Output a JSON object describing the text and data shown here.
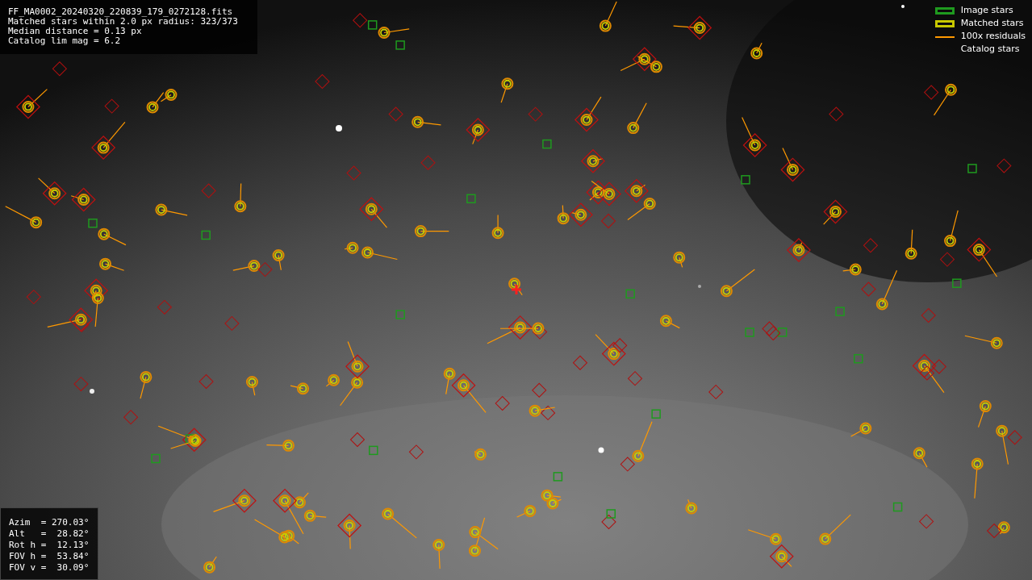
{
  "info": {
    "lines": [
      "FF_MA0002_20240320_220839_179_0272128.fits",
      "Matched stars within 2.0 px radius: 323/373",
      "Median distance = 0.13 px",
      "Catalog lim mag = 6.2"
    ]
  },
  "legend": [
    {
      "kind": "box",
      "label": "Image stars",
      "color": "#1f9a1f"
    },
    {
      "kind": "box",
      "label": "Matched stars",
      "color": "#c8c800"
    },
    {
      "kind": "line",
      "label": "100x residuals",
      "color": "#ff9900"
    },
    {
      "kind": "none",
      "label": "Catalog stars"
    }
  ],
  "pointing": {
    "lines": [
      "Azim  = 270.03°",
      "Alt   =  28.82°",
      "Rot h =  12.13°",
      "FOV h =  53.84°",
      "FOV v =  30.09°"
    ]
  }
}
